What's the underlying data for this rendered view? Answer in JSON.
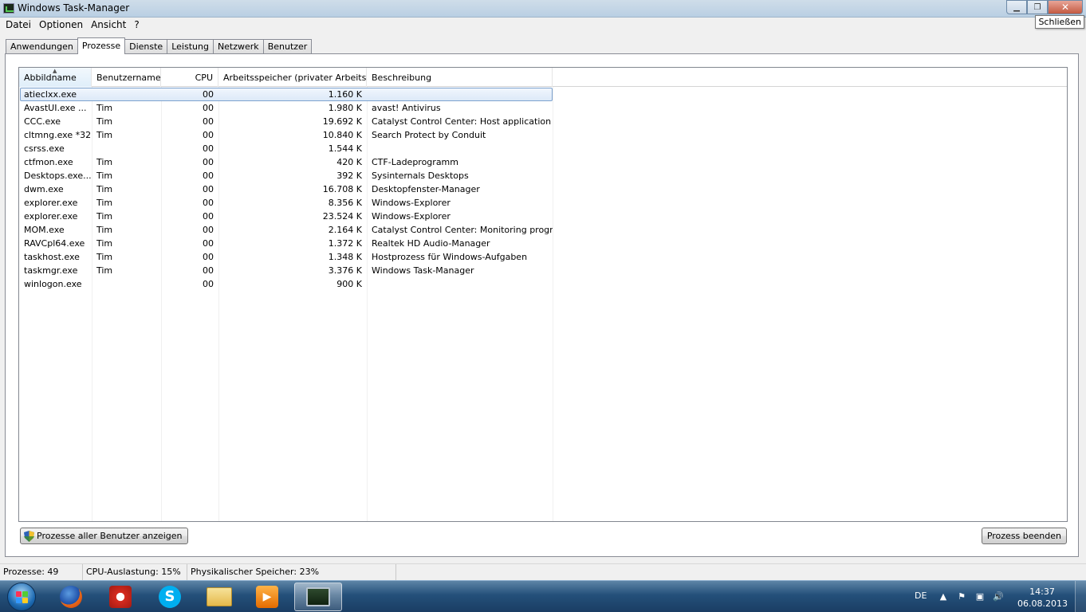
{
  "window": {
    "title": "Windows Task-Manager",
    "tooltip": "Schließen"
  },
  "menu": [
    "Datei",
    "Optionen",
    "Ansicht",
    "?"
  ],
  "tabs": [
    "Anwendungen",
    "Prozesse",
    "Dienste",
    "Leistung",
    "Netzwerk",
    "Benutzer"
  ],
  "active_tab": "Prozesse",
  "columns": [
    "Abbildname",
    "Benutzername",
    "CPU",
    "Arbeitsspeicher (privater Arbeitss...",
    "Beschreibung"
  ],
  "rows": [
    {
      "name": "atieclxx.exe",
      "user": "",
      "cpu": "00",
      "mem": "1.160 K",
      "desc": ""
    },
    {
      "name": "AvastUI.exe ...",
      "user": "Tim",
      "cpu": "00",
      "mem": "1.980 K",
      "desc": "avast! Antivirus"
    },
    {
      "name": "CCC.exe",
      "user": "Tim",
      "cpu": "00",
      "mem": "19.692 K",
      "desc": "Catalyst Control Center: Host application"
    },
    {
      "name": "cltmng.exe *32",
      "user": "Tim",
      "cpu": "00",
      "mem": "10.840 K",
      "desc": "Search Protect by Conduit"
    },
    {
      "name": "csrss.exe",
      "user": "",
      "cpu": "00",
      "mem": "1.544 K",
      "desc": ""
    },
    {
      "name": "ctfmon.exe",
      "user": "Tim",
      "cpu": "00",
      "mem": "420 K",
      "desc": "CTF-Ladeprogramm"
    },
    {
      "name": "Desktops.exe...",
      "user": "Tim",
      "cpu": "00",
      "mem": "392 K",
      "desc": "Sysinternals Desktops"
    },
    {
      "name": "dwm.exe",
      "user": "Tim",
      "cpu": "00",
      "mem": "16.708 K",
      "desc": "Desktopfenster-Manager"
    },
    {
      "name": "explorer.exe",
      "user": "Tim",
      "cpu": "00",
      "mem": "8.356 K",
      "desc": "Windows-Explorer"
    },
    {
      "name": "explorer.exe",
      "user": "Tim",
      "cpu": "00",
      "mem": "23.524 K",
      "desc": "Windows-Explorer"
    },
    {
      "name": "MOM.exe",
      "user": "Tim",
      "cpu": "00",
      "mem": "2.164 K",
      "desc": "Catalyst Control Center: Monitoring program"
    },
    {
      "name": "RAVCpl64.exe",
      "user": "Tim",
      "cpu": "00",
      "mem": "1.372 K",
      "desc": "Realtek HD Audio-Manager"
    },
    {
      "name": "taskhost.exe",
      "user": "Tim",
      "cpu": "00",
      "mem": "1.348 K",
      "desc": "Hostprozess für Windows-Aufgaben"
    },
    {
      "name": "taskmgr.exe",
      "user": "Tim",
      "cpu": "00",
      "mem": "3.376 K",
      "desc": "Windows Task-Manager"
    },
    {
      "name": "winlogon.exe",
      "user": "",
      "cpu": "00",
      "mem": "900 K",
      "desc": ""
    }
  ],
  "buttons": {
    "show_all": "Prozesse aller Benutzer anzeigen",
    "end_process": "Prozess beenden"
  },
  "status": {
    "processes": "Prozesse: 49",
    "cpu": "CPU-Auslastung: 15%",
    "memory": "Physikalischer Speicher: 23%"
  },
  "taskbar": {
    "items": [
      "firefox-icon",
      "ccleaner-icon",
      "skype-icon",
      "explorer-folder-icon",
      "media-player-icon",
      "task-manager-icon"
    ],
    "language": "DE",
    "time": "14:37",
    "date": "06.08.2013"
  }
}
